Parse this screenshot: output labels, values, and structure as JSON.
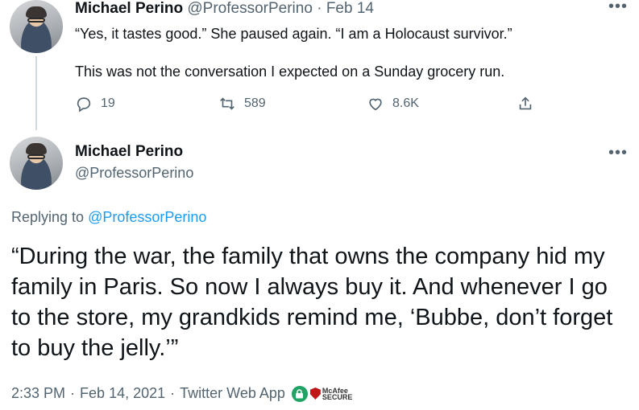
{
  "tweet1": {
    "author_name": "Michael Perino",
    "handle": "@ProfessorPerino",
    "separator": "·",
    "date": "Feb 14",
    "line1": "“Yes, it tastes good.” She paused again. “I am a Holocaust survivor.”",
    "line2": "This was not the conversation I expected on a Sunday grocery run.",
    "replies": "19",
    "retweets": "589",
    "likes": "8.6K"
  },
  "tweet2": {
    "author_name": "Michael Perino",
    "handle": "@ProfessorPerino",
    "replying_prefix": "Replying to",
    "replying_to": "@ProfessorPerino",
    "text": "“During the war, the family that owns the company hid my family in Paris. So now I always buy it. And whenever I go to the store, my grandkids remind me, ‘Bubbe, don’t forget to buy the jelly.’”",
    "time": "2:33 PM",
    "dot1": "·",
    "date": "Feb 14, 2021",
    "dot2": "·",
    "source": "Twitter Web App"
  },
  "badge": {
    "mcafee_line1": "McAfee",
    "mcafee_line2": "SECURE"
  },
  "colors": {
    "accent": "#1d9bf0",
    "muted": "#536471",
    "text": "#0f1419",
    "thread_line": "#cfd9de",
    "secure_green": "#21a366",
    "mcafee_red": "#c01818"
  },
  "icons": [
    "more-icon",
    "reply-icon",
    "retweet-icon",
    "like-icon",
    "share-icon",
    "lock-icon",
    "mcafee-shield-icon"
  ]
}
